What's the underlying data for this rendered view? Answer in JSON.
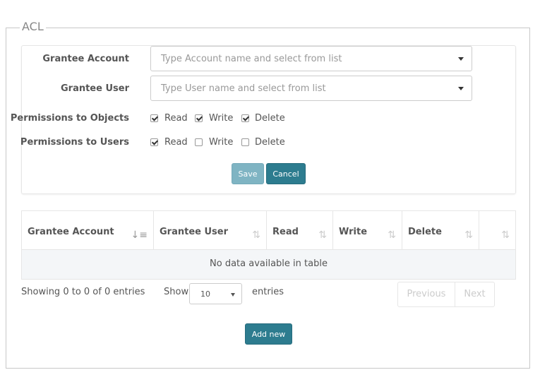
{
  "legend": "ACL",
  "form": {
    "grantee_account": {
      "label": "Grantee Account",
      "placeholder": "Type Account name and select from list"
    },
    "grantee_user": {
      "label": "Grantee User",
      "placeholder": "Type User name and select from list"
    },
    "perm_objects": {
      "label": "Permissions to Objects",
      "read": {
        "label": "Read",
        "checked": true
      },
      "write": {
        "label": "Write",
        "checked": true
      },
      "delete": {
        "label": "Delete",
        "checked": true
      }
    },
    "perm_users": {
      "label": "Permissions to Users",
      "read": {
        "label": "Read",
        "checked": true
      },
      "write": {
        "label": "Write",
        "checked": false
      },
      "delete": {
        "label": "Delete",
        "checked": false
      }
    },
    "save_label": "Save",
    "cancel_label": "Cancel"
  },
  "table": {
    "columns": [
      {
        "label": "Grantee Account",
        "sort": "ascending"
      },
      {
        "label": "Grantee User",
        "sort": "none"
      },
      {
        "label": "Read",
        "sort": "none"
      },
      {
        "label": "Write",
        "sort": "none"
      },
      {
        "label": "Delete",
        "sort": "none"
      },
      {
        "label": "",
        "sort": "none"
      }
    ],
    "empty_message": "No data available in table"
  },
  "footer": {
    "info": "Showing 0 to 0 of 0 entries",
    "show_label": "Show",
    "page_length": "10",
    "entries_label": "entries",
    "previous_label": "Previous",
    "next_label": "Next",
    "add_new_label": "Add new"
  }
}
